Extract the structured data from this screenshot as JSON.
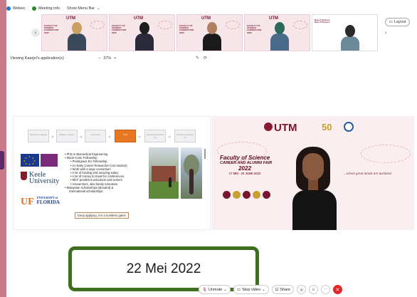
{
  "topbar": {
    "app_label": "Webex",
    "meeting_info": "Meeting info",
    "show_menu_bar": "Show Menu Bar"
  },
  "layout_button": "Layout",
  "participant_tiles": [
    {
      "kind": "slide-person",
      "utm": "UTM"
    },
    {
      "kind": "slide-person",
      "utm": "UTM"
    },
    {
      "kind": "slide-person",
      "utm": "UTM"
    },
    {
      "kind": "slide-person",
      "utm": "UTM"
    },
    {
      "kind": "empty-person",
      "utm": ""
    }
  ],
  "viewing": "Viewing Kaarjel's application(s)",
  "zoom": {
    "minus": "−",
    "value": "37%",
    "plus": "+"
  },
  "presentation": {
    "flow": [
      {
        "label": "Bachelor's degree",
        "active": false
      },
      {
        "label": "Master's degree",
        "active": false
      },
      {
        "label": "Internship",
        "active": false
      },
      {
        "label": "PhD",
        "active": true
      },
      {
        "label": "Postdoc Research (1)",
        "active": false
      },
      {
        "label": "Postdoc Research (2)",
        "active": false
      }
    ],
    "keele": "Keele University",
    "uf": {
      "u": "UF",
      "line1": "UNIVERSITY of",
      "line2": "FLORIDA"
    },
    "bullets": [
      {
        "level": 1,
        "text": "PhD in Biomedical Engineering"
      },
      {
        "level": 1,
        "text": "Marie-Curie Fellowship"
      },
      {
        "level": 2,
        "text": "Prestigious EU Fellowship"
      },
      {
        "level": 2,
        "text": "An Early Career Researcher (not student)"
      },
      {
        "level": 2,
        "text": "Work with a large consortium"
      },
      {
        "level": 2,
        "text": "A lot of funding and amazing salary"
      },
      {
        "level": 2,
        "text": "A lot of money to travel for conferences"
      },
      {
        "level": 2,
        "text": "MCF prioritizes education and women"
      },
      {
        "level": 2,
        "text": "researchers, also family relocation"
      },
      {
        "level": 1,
        "text": "Malaysian scholarships (Bonded) &"
      },
      {
        "level": 1,
        "text": "International scholarships"
      }
    ],
    "keep_applying": "Keep applying, it is a numbers game"
  },
  "speaker": {
    "utm": "UTM",
    "fifty": "50",
    "title_line1": "Faculty of Science",
    "title_line2": "CAREER AND ALUMNI FAIR",
    "title_line3": "2022",
    "dates": "17 MEI - 20 JUNE 2022",
    "slogan": "...where great minds are nurtured"
  },
  "date_caption": "22 Mei 2022",
  "controls": {
    "unmute": "Unmute",
    "stop_video": "Stop video",
    "share": "Share"
  },
  "colors": {
    "brand_maroon": "#7a1230",
    "flow_active": "#e87722",
    "date_border": "#3d6f1f",
    "end_call": "#e02a2a"
  }
}
